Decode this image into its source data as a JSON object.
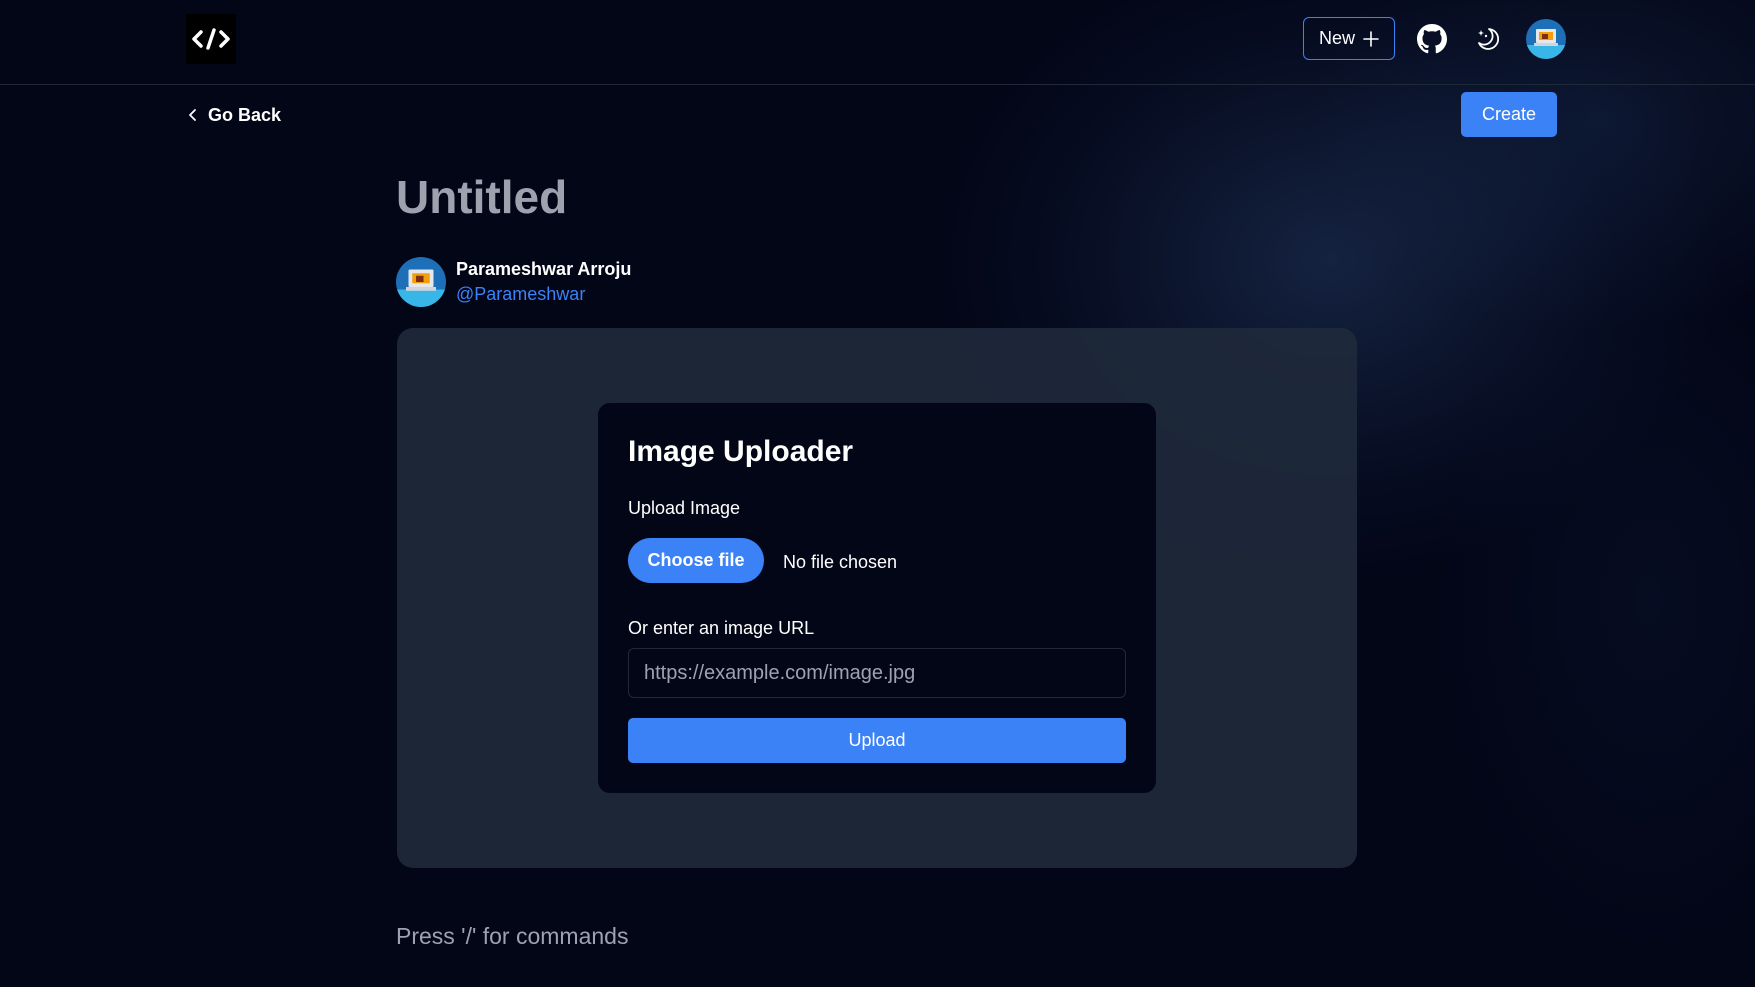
{
  "header": {
    "logo_icon": "code-brackets-icon",
    "new_label": "New",
    "new_icon": "plus-icon",
    "github_icon": "github-icon",
    "theme_icon": "moon-sparkle-icon",
    "avatar_icon": "user-avatar"
  },
  "nav": {
    "go_back_label": "Go Back",
    "create_label": "Create"
  },
  "document": {
    "title": "Untitled",
    "author": {
      "name": "Parameshwar Arroju",
      "handle": "@Parameshwar"
    },
    "command_hint": "Press '/' for commands"
  },
  "uploader": {
    "title": "Image Uploader",
    "upload_label": "Upload Image",
    "choose_file_label": "Choose file",
    "file_status": "No file chosen",
    "url_label": "Or enter an image URL",
    "url_placeholder": "https://example.com/image.jpg",
    "url_value": "",
    "upload_button_label": "Upload"
  },
  "colors": {
    "accent": "#3b82f6",
    "background": "#030617",
    "panel": "#1e293b",
    "muted_text": "#9ca3af"
  }
}
